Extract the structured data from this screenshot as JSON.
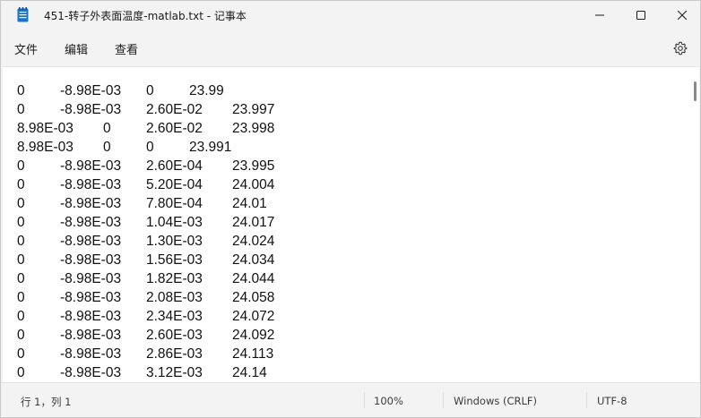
{
  "window": {
    "title": "451-转子外表面温度-matlab.txt - 记事本"
  },
  "menu": {
    "items": [
      "文件",
      "编辑",
      "查看"
    ]
  },
  "editor": {
    "lines": [
      [
        "0",
        "-8.98E-03",
        "0",
        "23.99"
      ],
      [
        "0",
        "-8.98E-03",
        "2.60E-02",
        "23.997"
      ],
      [
        "8.98E-03",
        "0",
        "2.60E-02",
        "23.998"
      ],
      [
        "8.98E-03",
        "0",
        "0",
        "23.991"
      ],
      [
        "0",
        "-8.98E-03",
        "2.60E-04",
        "23.995"
      ],
      [
        "0",
        "-8.98E-03",
        "5.20E-04",
        "24.004"
      ],
      [
        "0",
        "-8.98E-03",
        "7.80E-04",
        "24.01"
      ],
      [
        "0",
        "-8.98E-03",
        "1.04E-03",
        "24.017"
      ],
      [
        "0",
        "-8.98E-03",
        "1.30E-03",
        "24.024"
      ],
      [
        "0",
        "-8.98E-03",
        "1.56E-03",
        "24.034"
      ],
      [
        "0",
        "-8.98E-03",
        "1.82E-03",
        "24.044"
      ],
      [
        "0",
        "-8.98E-03",
        "2.08E-03",
        "24.058"
      ],
      [
        "0",
        "-8.98E-03",
        "2.34E-03",
        "24.072"
      ],
      [
        "0",
        "-8.98E-03",
        "2.60E-03",
        "24.092"
      ],
      [
        "0",
        "-8.98E-03",
        "2.86E-03",
        "24.113"
      ],
      [
        "0",
        "-8.98E-03",
        "3.12E-03",
        "24.14"
      ]
    ]
  },
  "status": {
    "position": "行 1，列 1",
    "zoom": "100%",
    "line_ending": "Windows (CRLF)",
    "encoding": "UTF-8"
  },
  "icons": {
    "app": "notepad-icon",
    "minimize": "minimize-icon",
    "maximize": "maximize-icon",
    "close": "close-icon",
    "settings": "gear-icon"
  },
  "colors": {
    "chrome": "#f3f3f3",
    "editor_bg": "#ffffff",
    "app_icon": "#1a73c9"
  }
}
